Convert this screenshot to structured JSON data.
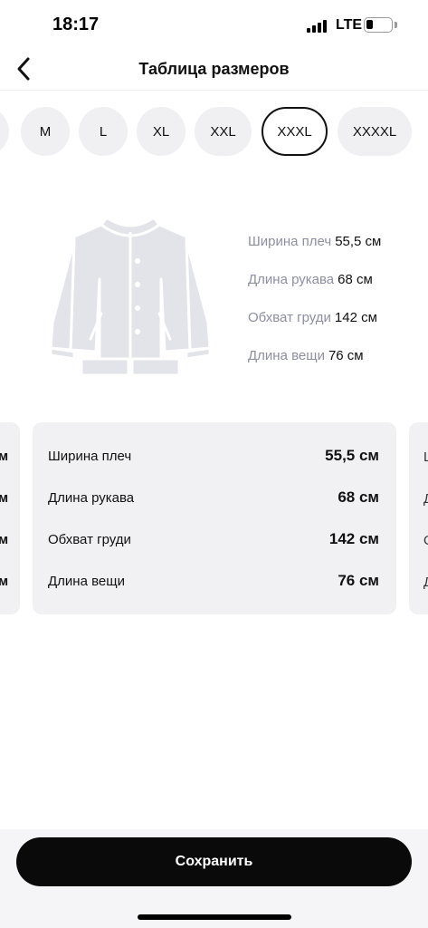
{
  "status_bar": {
    "time": "18:17",
    "network": "LTE",
    "battery_level": 0.25
  },
  "header": {
    "title": "Таблица размеров",
    "back_icon": "chevron-left-icon"
  },
  "sizes": {
    "items": [
      "M",
      "L",
      "XL",
      "XXL",
      "XXXL",
      "XXXXL"
    ],
    "selected": "XXXL"
  },
  "illustration": {
    "icon": "jacket-icon",
    "color": "#e3e3ea"
  },
  "measurements": [
    {
      "label": "Ширина плеч",
      "value": "55,5 см"
    },
    {
      "label": "Длина рукава",
      "value": "68 см"
    },
    {
      "label": "Обхват груди",
      "value": "142 см"
    },
    {
      "label": "Длина вещи",
      "value": "76 см"
    }
  ],
  "save_button": {
    "label": "Сохранить"
  },
  "colors": {
    "accent": "#0a0a0a",
    "chip_bg": "#f0f0f3",
    "card_bg": "#f1f1f4",
    "muted_text": "#8e8ea3"
  }
}
